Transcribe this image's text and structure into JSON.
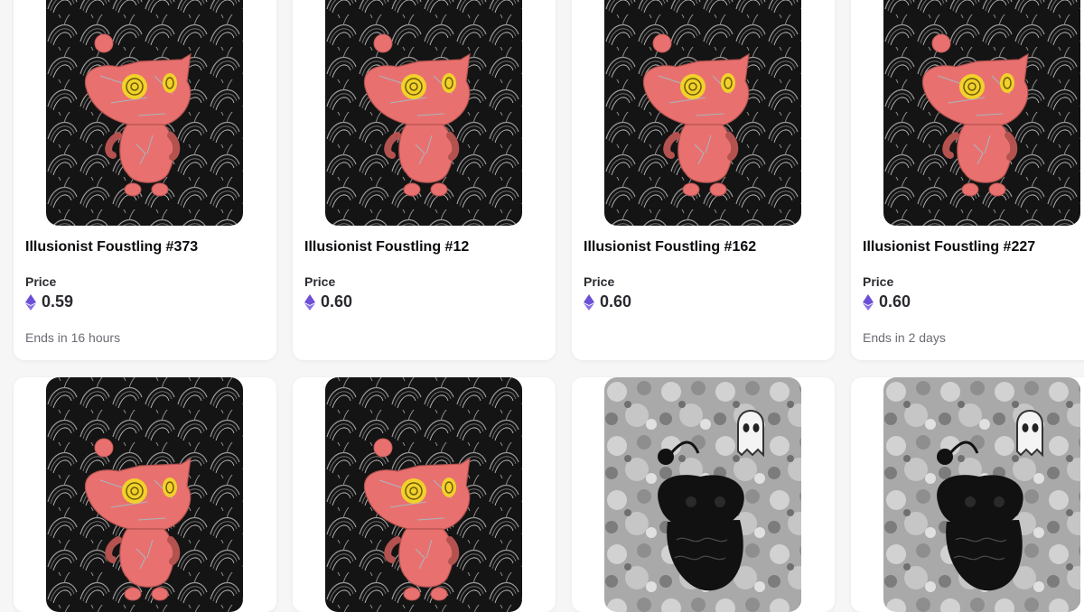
{
  "cards": [
    {
      "name": "Illusionist Foustling #373",
      "price_label": "Price",
      "price": "0.59",
      "currency_icon": "ethereum-icon",
      "ends": "Ends in 16 hours",
      "art": "foustling-pink-swirl"
    },
    {
      "name": "Illusionist Foustling #12",
      "price_label": "Price",
      "price": "0.60",
      "currency_icon": "ethereum-icon",
      "ends": "",
      "art": "foustling-pink-swirl"
    },
    {
      "name": "Illusionist Foustling #162",
      "price_label": "Price",
      "price": "0.60",
      "currency_icon": "ethereum-icon",
      "ends": "",
      "art": "foustling-pink-swirl"
    },
    {
      "name": "Illusionist Foustling #227",
      "price_label": "Price",
      "price": "0.60",
      "currency_icon": "ethereum-icon",
      "ends": "Ends in 2 days",
      "art": "foustling-pink-swirl"
    },
    {
      "art": "foustling-pink-swirl"
    },
    {
      "art": "foustling-pink-swirl"
    },
    {
      "art": "foustling-black-ghost"
    },
    {
      "art": "foustling-black-ghost"
    }
  ],
  "colors": {
    "eth_purple": "#6c4fd6",
    "creature_pink": "#e8716f",
    "eye_yellow": "#f2d12a",
    "swirl_bg": "#141414"
  }
}
